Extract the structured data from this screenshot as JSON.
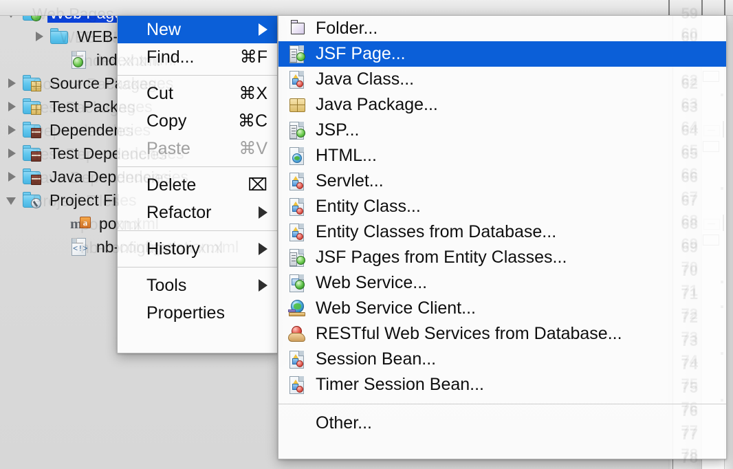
{
  "explorer": {
    "tree": [
      {
        "label": "Web Pages",
        "icon": "folder-web-icon",
        "twisty": "open",
        "indent": 8,
        "selected": true,
        "type": "folder-globe"
      },
      {
        "label": "WEB-INF",
        "icon": "folder-icon",
        "twisty": "closed",
        "indent": 48,
        "selected": false,
        "type": "folder-plain"
      },
      {
        "label": "index.xhtml",
        "icon": "file-xhtml-icon",
        "twisty": "none",
        "indent": 78,
        "selected": false,
        "type": "doc-globe"
      },
      {
        "label": "Source Packages",
        "icon": "folder-packages-icon",
        "twisty": "closed",
        "indent": 8,
        "selected": false,
        "type": "folder-pkg"
      },
      {
        "label": "Test Packages",
        "icon": "folder-packages-icon",
        "twisty": "closed",
        "indent": 8,
        "selected": false,
        "type": "folder-pkg"
      },
      {
        "label": "Dependencies",
        "icon": "folder-libraries-icon",
        "twisty": "closed",
        "indent": 8,
        "selected": false,
        "type": "folder-books"
      },
      {
        "label": "Test Dependencies",
        "icon": "folder-libraries-icon",
        "twisty": "closed",
        "indent": 8,
        "selected": false,
        "type": "folder-books"
      },
      {
        "label": "Java Dependencies",
        "icon": "folder-libraries-icon",
        "twisty": "closed",
        "indent": 8,
        "selected": false,
        "type": "folder-books"
      },
      {
        "label": "Project Files",
        "icon": "folder-project-icon",
        "twisty": "open",
        "indent": 8,
        "selected": false,
        "type": "folder-wrench"
      },
      {
        "label": "pom.xml",
        "icon": "maven-file-icon",
        "twisty": "none",
        "indent": 78,
        "selected": false,
        "type": "maven"
      },
      {
        "label": "nb-configuration.xml",
        "icon": "xml-file-icon",
        "twisty": "none",
        "indent": 78,
        "selected": false,
        "type": "doc-xml"
      }
    ]
  },
  "editor": {
    "line_numbers": [
      "59",
      "60",
      "61",
      "62",
      "63",
      "64",
      "65",
      "66",
      "67",
      "68",
      "69",
      "70",
      "71",
      "72",
      "73",
      "74",
      "75",
      "76",
      "77",
      "78"
    ],
    "highlighted_line": "61"
  },
  "context_menu": {
    "items": [
      {
        "label": "New",
        "accel": "",
        "submenu": true,
        "selected": true,
        "disabled": false
      },
      {
        "label": "Find...",
        "accel": "⌘F",
        "submenu": false,
        "selected": false,
        "disabled": false
      },
      {
        "separator": true
      },
      {
        "label": "Cut",
        "accel": "⌘X",
        "submenu": false,
        "selected": false,
        "disabled": false
      },
      {
        "label": "Copy",
        "accel": "⌘C",
        "submenu": false,
        "selected": false,
        "disabled": false
      },
      {
        "label": "Paste",
        "accel": "⌘V",
        "submenu": false,
        "selected": false,
        "disabled": true
      },
      {
        "separator": true
      },
      {
        "label": "Delete",
        "accel": "⌧",
        "submenu": false,
        "selected": false,
        "disabled": false
      },
      {
        "label": "Refactor",
        "accel": "",
        "submenu": true,
        "selected": false,
        "disabled": false
      },
      {
        "separator": true
      },
      {
        "label": "History",
        "accel": "",
        "submenu": true,
        "selected": false,
        "disabled": false
      },
      {
        "separator": true
      },
      {
        "label": "Tools",
        "accel": "",
        "submenu": true,
        "selected": false,
        "disabled": false
      },
      {
        "label": "Properties",
        "accel": "",
        "submenu": false,
        "selected": false,
        "disabled": false
      }
    ]
  },
  "new_submenu": {
    "items": [
      {
        "label": "Folder...",
        "icon": "new-folder-icon",
        "icon_class": "i-folder",
        "selected": false
      },
      {
        "label": "JSF Page...",
        "icon": "jsf-page-icon",
        "icon_class": "i-jsf",
        "selected": true
      },
      {
        "label": "Java Class...",
        "icon": "java-class-icon",
        "icon_class": "i-java",
        "selected": false
      },
      {
        "label": "Java Package...",
        "icon": "java-package-icon",
        "icon_class": "i-pkg",
        "selected": false
      },
      {
        "label": "JSP...",
        "icon": "jsp-icon",
        "icon_class": "i-jsf",
        "selected": false
      },
      {
        "label": "HTML...",
        "icon": "html-file-icon",
        "icon_class": "i-html",
        "selected": false
      },
      {
        "label": "Servlet...",
        "icon": "servlet-icon",
        "icon_class": "i-java",
        "selected": false
      },
      {
        "label": "Entity Class...",
        "icon": "entity-class-icon",
        "icon_class": "i-java",
        "selected": false
      },
      {
        "label": "Entity Classes from Database...",
        "icon": "entity-classes-db-icon",
        "icon_class": "i-java",
        "selected": false
      },
      {
        "label": "JSF Pages from Entity Classes...",
        "icon": "jsf-pages-entity-icon",
        "icon_class": "i-jsf",
        "selected": false
      },
      {
        "label": "Web Service...",
        "icon": "web-service-icon",
        "icon_class": "i-ws",
        "selected": false
      },
      {
        "label": "Web Service Client...",
        "icon": "web-service-client-icon",
        "icon_class": "i-wsc",
        "selected": false
      },
      {
        "label": "RESTful Web Services from Database...",
        "icon": "restful-services-icon",
        "icon_class": "i-rest",
        "selected": false
      },
      {
        "label": "Session Bean...",
        "icon": "session-bean-icon",
        "icon_class": "i-java",
        "selected": false
      },
      {
        "label": "Timer Session Bean...",
        "icon": "timer-session-bean-icon",
        "icon_class": "i-java",
        "selected": false
      },
      {
        "separator": true
      },
      {
        "label": "Other...",
        "icon": "",
        "icon_class": "",
        "selected": false
      }
    ]
  },
  "colors": {
    "selection_blue": "#0b42d8",
    "menu_highlight_blue": "#0b5fd8",
    "menu_background": "#fdfdfd",
    "panel_background": "#d9d9d9"
  }
}
